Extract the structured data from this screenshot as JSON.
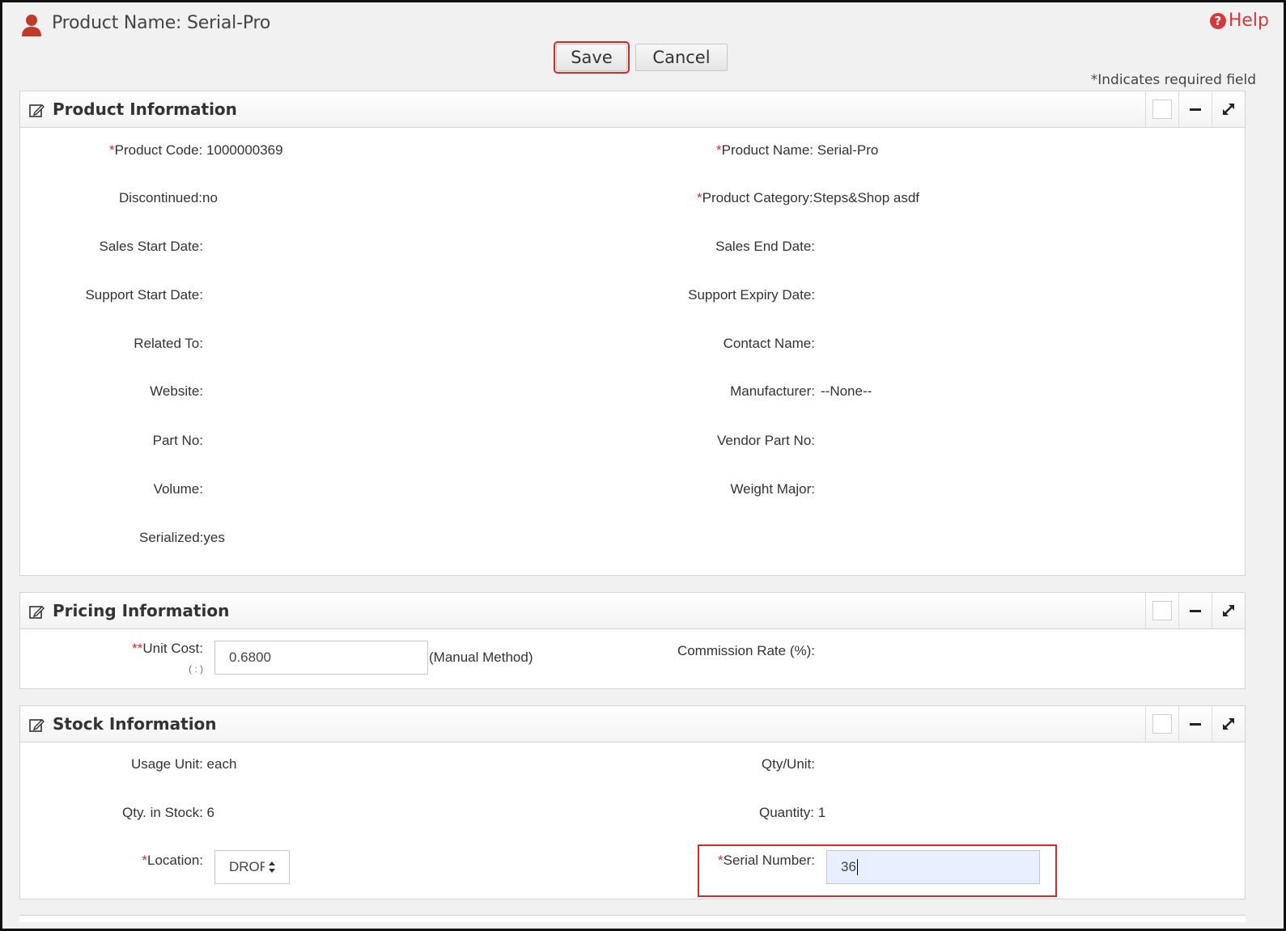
{
  "header": {
    "title": "Product Name: Serial-Pro",
    "help_label": "Help"
  },
  "toolbar": {
    "save_label": "Save",
    "cancel_label": "Cancel"
  },
  "required_note": "*Indicates required field",
  "product_information": {
    "title": "Product Information",
    "product_code_label": "Product Code:",
    "product_code_value": "1000000369",
    "product_name_label": "Product Name:",
    "product_name_value": "Serial-Pro",
    "discontinued": "Discontinued:no",
    "product_category": "Product Category:Steps&Shop asdf",
    "sales_start_date_label": "Sales Start Date:",
    "sales_end_date_label": "Sales End Date:",
    "support_start_date_label": "Support Start Date:",
    "support_expiry_date_label": "Support Expiry Date:",
    "related_to_label": "Related To:",
    "contact_name_label": "Contact Name:",
    "website_label": "Website:",
    "manufacturer_label": "Manufacturer:",
    "manufacturer_value": "--None--",
    "part_no_label": "Part No:",
    "vendor_part_no_label": "Vendor Part No:",
    "volume_label": "Volume:",
    "weight_major_label": "Weight Major:",
    "serialized": "Serialized:yes"
  },
  "pricing_information": {
    "title": "Pricing Information",
    "unit_cost_label": "Unit Cost:",
    "unit_cost_sub": "( : )",
    "unit_cost_value": "0.6800",
    "unit_cost_method": "(Manual Method)",
    "commission_rate_label": "Commission Rate (%):"
  },
  "stock_information": {
    "title": "Stock Information",
    "usage_unit": "Usage Unit: each",
    "qty_unit_label": "Qty/Unit:",
    "qty_in_stock": "Qty. in Stock: 6",
    "quantity": "Quantity: 1",
    "location_label": "Location:",
    "location_value": "DROF",
    "serial_number_label": "Serial Number:",
    "serial_number_value": "36"
  },
  "colors": {
    "required": "#d42a2a",
    "help": "#d6393a",
    "user_icon": "#c0392b",
    "focused_input": "#e8efff"
  }
}
